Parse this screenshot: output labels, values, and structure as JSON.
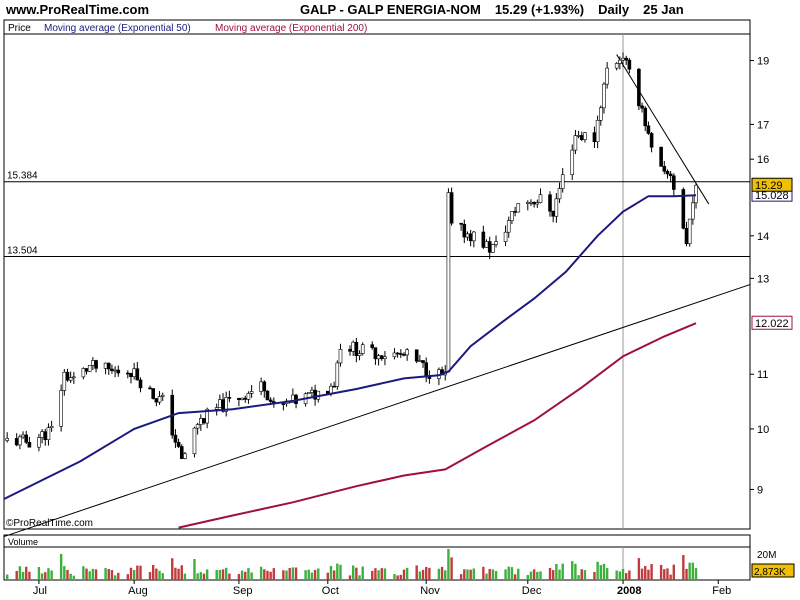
{
  "header": {
    "site": "www.ProRealTime.com",
    "symbol": "GALP - GALP ENERGIA-NOM",
    "quote": "15.29 (+1.93%)",
    "period": "Daily",
    "date": "25 Jan"
  },
  "legend": {
    "price": "Price",
    "ma50": "Moving average (Exponential 50)",
    "ma200": "Moving average (Exponential 200)"
  },
  "watermark": "©ProRealTime.com",
  "colors": {
    "ma50": "#1a1a80",
    "ma200": "#a0103c",
    "up_candle": "#ffffff",
    "down_candle": "#000000",
    "vol_up": "#3cb03c",
    "vol_down": "#c03c3c",
    "last_tag": "#f0c000"
  },
  "chart_data": {
    "type": "candlestick",
    "scale": "log",
    "y_ticks": [
      9,
      10,
      11,
      13,
      14,
      16,
      17,
      19
    ],
    "ylim": [
      8.4,
      19.9
    ],
    "x_labels": [
      {
        "label": "Jul",
        "date": "2007-07-02"
      },
      {
        "label": "Aug",
        "date": "2007-08-01"
      },
      {
        "label": "Sep",
        "date": "2007-09-03"
      },
      {
        "label": "Oct",
        "date": "2007-10-01"
      },
      {
        "label": "Nov",
        "date": "2007-11-01"
      },
      {
        "label": "Dec",
        "date": "2007-12-03"
      },
      {
        "label": "2008",
        "date": "2008-01-02"
      },
      {
        "label": "Feb",
        "date": "2008-02-01"
      }
    ],
    "xlim": [
      "2007-06-21",
      "2008-02-11"
    ],
    "h_levels": [
      {
        "label": "15.384",
        "value": 15.384
      },
      {
        "label": "13.504",
        "value": 13.504
      }
    ],
    "trendlines": [
      {
        "from": [
          "2007-06-21",
          8.29
        ],
        "to": [
          "2008-02-11",
          12.86
        ]
      },
      {
        "from": [
          "2007-12-31",
          19.2
        ],
        "to": [
          "2008-01-29",
          14.8
        ]
      }
    ],
    "year_marker": "2008-01-02",
    "price_path": [
      [
        "2007-06-22",
        9.8
      ],
      [
        "2007-06-29",
        9.78
      ],
      [
        "2007-07-06",
        9.98
      ],
      [
        "2007-07-10",
        11.0
      ],
      [
        "2007-07-13",
        10.9
      ],
      [
        "2007-07-18",
        11.15
      ],
      [
        "2007-07-25",
        11.05
      ],
      [
        "2007-07-31",
        11.08
      ],
      [
        "2007-08-07",
        10.6
      ],
      [
        "2007-08-10",
        10.5
      ],
      [
        "2007-08-16",
        9.45
      ],
      [
        "2007-08-21",
        10.1
      ],
      [
        "2007-08-28",
        10.4
      ],
      [
        "2007-09-04",
        10.6
      ],
      [
        "2007-09-11",
        10.8
      ],
      [
        "2007-09-14",
        10.35
      ],
      [
        "2007-09-21",
        10.5
      ],
      [
        "2007-09-28",
        10.65
      ],
      [
        "2007-10-03",
        10.85
      ],
      [
        "2007-10-05",
        11.6
      ],
      [
        "2007-10-12",
        11.45
      ],
      [
        "2007-10-19",
        11.4
      ],
      [
        "2007-10-26",
        11.35
      ],
      [
        "2007-11-02",
        11.05
      ],
      [
        "2007-11-07",
        10.95
      ],
      [
        "2007-11-08",
        15.0
      ],
      [
        "2007-11-09",
        14.2
      ],
      [
        "2007-11-16",
        14.0
      ],
      [
        "2007-11-21",
        13.7
      ],
      [
        "2007-11-23",
        13.75
      ],
      [
        "2007-11-30",
        14.8
      ],
      [
        "2007-12-04",
        14.9
      ],
      [
        "2007-12-07",
        14.9
      ],
      [
        "2007-12-11",
        14.6
      ],
      [
        "2007-12-14",
        15.5
      ],
      [
        "2007-12-18",
        16.7
      ],
      [
        "2007-12-24",
        16.6
      ],
      [
        "2007-12-28",
        18.7
      ],
      [
        "2008-01-02",
        19.2
      ],
      [
        "2008-01-04",
        18.5
      ],
      [
        "2008-01-08",
        17.5
      ],
      [
        "2008-01-11",
        16.2
      ],
      [
        "2008-01-15",
        15.5
      ],
      [
        "2008-01-17",
        15.6
      ],
      [
        "2008-01-21",
        14.2
      ],
      [
        "2008-01-22",
        13.8
      ],
      [
        "2008-01-24",
        15.0
      ],
      [
        "2008-01-25",
        15.29
      ]
    ],
    "ema50_path": [
      [
        "2007-06-21",
        8.85
      ],
      [
        "2007-07-15",
        9.45
      ],
      [
        "2007-08-01",
        10.0
      ],
      [
        "2007-08-15",
        10.28
      ],
      [
        "2007-09-01",
        10.35
      ],
      [
        "2007-09-20",
        10.5
      ],
      [
        "2007-10-10",
        10.72
      ],
      [
        "2007-10-25",
        10.92
      ],
      [
        "2007-11-05",
        10.98
      ],
      [
        "2007-11-08",
        11.05
      ],
      [
        "2007-11-15",
        11.55
      ],
      [
        "2007-11-25",
        12.05
      ],
      [
        "2007-12-05",
        12.55
      ],
      [
        "2007-12-15",
        13.15
      ],
      [
        "2007-12-25",
        14.0
      ],
      [
        "2008-01-02",
        14.6
      ],
      [
        "2008-01-10",
        15.0
      ],
      [
        "2008-01-18",
        15.0
      ],
      [
        "2008-01-25",
        15.028
      ]
    ],
    "ema200_path": [
      [
        "2007-08-15",
        8.42
      ],
      [
        "2007-09-01",
        8.6
      ],
      [
        "2007-09-20",
        8.8
      ],
      [
        "2007-10-10",
        9.05
      ],
      [
        "2007-10-25",
        9.22
      ],
      [
        "2007-11-07",
        9.32
      ],
      [
        "2007-11-20",
        9.7
      ],
      [
        "2007-12-05",
        10.15
      ],
      [
        "2007-12-20",
        10.75
      ],
      [
        "2008-01-02",
        11.35
      ],
      [
        "2008-01-15",
        11.75
      ],
      [
        "2008-01-25",
        12.022
      ]
    ],
    "last_price": "15.29",
    "ema50_last": "15.028",
    "ema200_last": "12.022",
    "volume": {
      "label": "Volume",
      "max_label": "20M",
      "last_label": "2,873K",
      "max_value": 20000000,
      "last_value": 2873000
    }
  }
}
